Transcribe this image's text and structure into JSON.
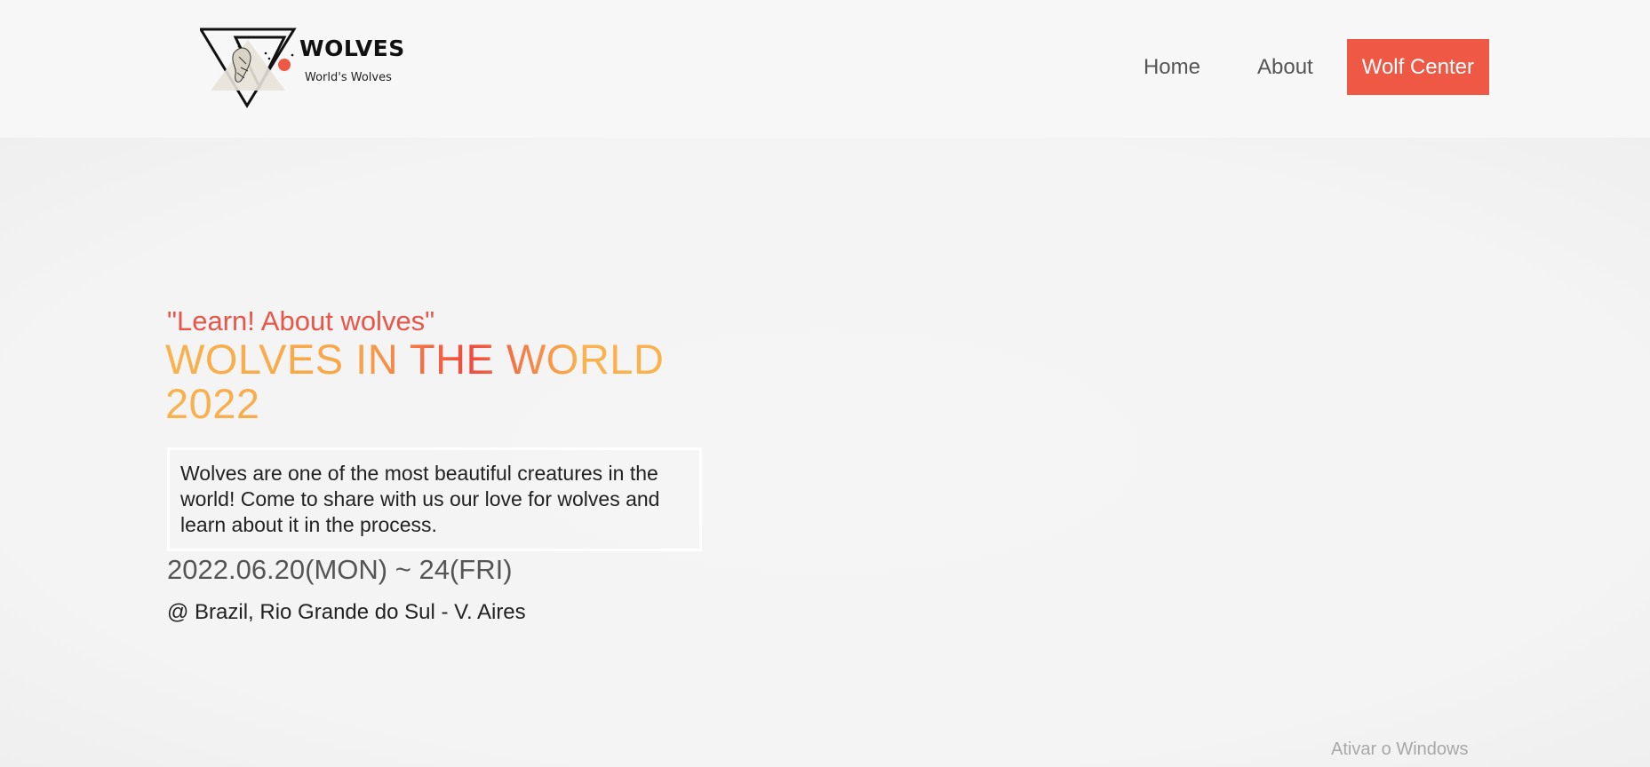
{
  "header": {
    "logo": {
      "title": "WOLVES",
      "subtitle": "World's Wolves",
      "icon": "wolf-triangle-logo"
    },
    "nav": {
      "home": "Home",
      "about": "About",
      "cta": "Wolf Center"
    }
  },
  "hero": {
    "tagline": "\"Learn! About wolves\"",
    "headline": "WOLVES IN THE WORLD 2022",
    "description": "Wolves are one of the most beautiful creatures in the world! Come to share with us our love for wolves and learn about it in the process.",
    "date": "2022.06.20(MON) ~ 24(FRI)",
    "location": "@ Brazil, Rio Grande do Sul - V. Aires"
  },
  "system": {
    "watermark": "Ativar o Windows"
  },
  "colors": {
    "accent": "#ee5844",
    "headline": "#f7a64a",
    "tagline": "#e8564a"
  }
}
